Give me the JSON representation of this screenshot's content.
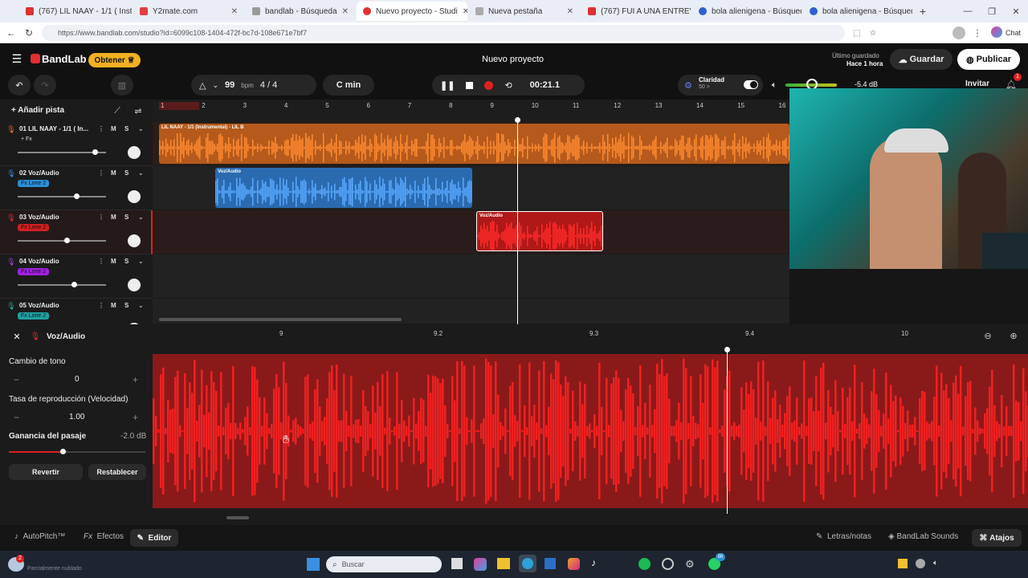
{
  "browser": {
    "tabs": [
      {
        "label": "(767) LIL NAAY - 1/1 ( Instru",
        "color": "#e03030"
      },
      {
        "label": "Y2mate.com",
        "color": "#e04040"
      },
      {
        "label": "bandlab - Búsqueda",
        "color": "#888888"
      },
      {
        "label": "Nuevo proyecto - Studi",
        "color": "#e03030"
      },
      {
        "label": "Nueva pestaña",
        "color": "#888888"
      },
      {
        "label": "(767) FUI A UNA ENTREVIST",
        "color": "#e03030"
      },
      {
        "label": "bola alienigena - Búsqueda",
        "color": "#3060d0"
      },
      {
        "label": "bola alienigena - Búsqueda",
        "color": "#3060d0"
      }
    ],
    "url": "https://www.bandlab.com/studio?id=6099c108-1404-472f-bc7d-108e671e7bf7",
    "chat_label": "Chat"
  },
  "app": {
    "brand": "BandLab",
    "obtener": "Obtener",
    "project_title": "Nuevo proyecto",
    "saved_line1": "Último guardado",
    "saved_line2": "Hace 1 hora",
    "save": "Guardar",
    "publish": "Publicar",
    "invite": "Invitar",
    "notif_count": "1"
  },
  "toolbar": {
    "bpm": "99",
    "bpm_label": "bpm",
    "time_sig": "4 / 4",
    "key": "C min",
    "time": "00:21.1",
    "claridad": "Claridad",
    "claridad_sub": "50 >",
    "volume_db": "-5.4 dB"
  },
  "tracks_header": {
    "add_track": "Añadir pista"
  },
  "tracks": [
    {
      "name": "01  LIL NAAY - 1/1 ( In...",
      "fx": "+ Fx",
      "fx_color": "#1b1b1b",
      "icon_color": "#f07030",
      "slider": 0.87
    },
    {
      "name": "02  Voz/Audio",
      "fx": "Fx Lone 2",
      "fx_color": "#2a8fd8",
      "icon_color": "#3a8fe0",
      "slider": 0.66
    },
    {
      "name": "03  Voz/Audio",
      "fx": "Fx Lone 2",
      "fx_color": "#d02020",
      "icon_color": "#e03030",
      "slider": 0.55
    },
    {
      "name": "04  Voz/Audio",
      "fx": "Fx Lone 2",
      "fx_color": "#a020e0",
      "icon_color": "#a040e0",
      "slider": 0.64
    },
    {
      "name": "05  Voz/Audio",
      "fx": "Fx Lone 2",
      "fx_color": "#20a0a0",
      "icon_color": "#20b0a0",
      "slider": 0.5
    }
  ],
  "ruler": [
    "1",
    "2",
    "3",
    "4",
    "5",
    "6",
    "7",
    "8",
    "9",
    "10",
    "11",
    "12",
    "13",
    "14",
    "15",
    "16"
  ],
  "clips": [
    {
      "label": "LIL NAAY - 1/1 (Instrumental) - LIL B",
      "color": "#e06a20"
    },
    {
      "label": "Voz/Audio",
      "color": "#3a8fe0"
    },
    {
      "label": "Voz/Audio",
      "color": "#e02020"
    }
  ],
  "editor": {
    "track_name": "Voz/Audio",
    "pitch_label": "Cambio de tono",
    "pitch_value": "0",
    "rate_label": "Tasa de reproducción (Velocidad)",
    "rate_value": "1.00",
    "gain_label": "Ganancia del pasaje",
    "gain_value": "-2.0 dB",
    "revert": "Revertir",
    "reset": "Restablecer",
    "ruler": [
      "9",
      "9.2",
      "9.3",
      "9.4",
      "10"
    ]
  },
  "bottom": {
    "autopitch": "AutoPitch™",
    "effects": "Efectos",
    "editor": "Editor",
    "lyrics": "Letras/notas",
    "sounds": "BandLab Sounds",
    "shortcuts": "Atajos"
  },
  "taskbar": {
    "search": "Buscar",
    "weather_badge": "2",
    "weather_text": "Parcialmente nublado",
    "badge_86": "86"
  }
}
